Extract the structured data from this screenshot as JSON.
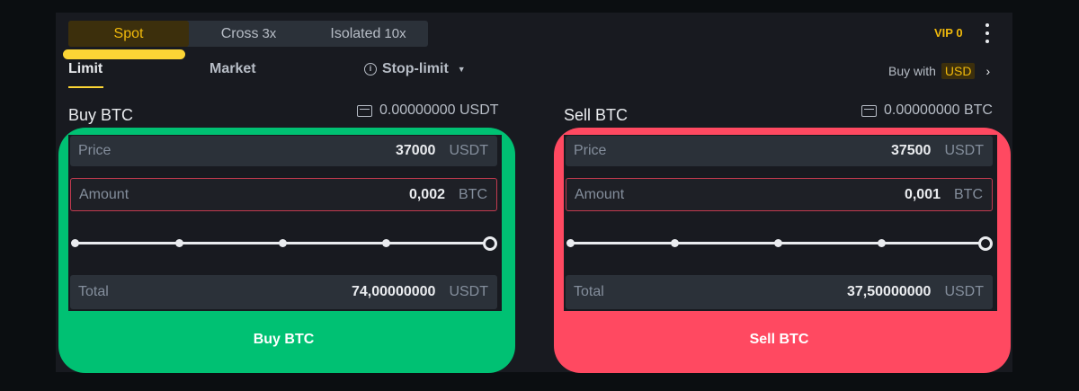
{
  "mode_tabs": [
    {
      "label": "Spot",
      "leverage": ""
    },
    {
      "label": "Cross",
      "leverage": "3x"
    },
    {
      "label": "Isolated",
      "leverage": "10x"
    }
  ],
  "vip_label": "VIP 0",
  "order_tabs": {
    "limit": "Limit",
    "market": "Market",
    "stop_limit": "Stop-limit"
  },
  "buy_with": {
    "label": "Buy with",
    "currency": "USD"
  },
  "buy": {
    "title": "Buy BTC",
    "balance": "0.00000000 USDT",
    "price": {
      "label": "Price",
      "value": "37000",
      "unit": "USDT"
    },
    "amount": {
      "label": "Amount",
      "value": "0,002",
      "unit": "BTC"
    },
    "total": {
      "label": "Total",
      "value": "74,00000000",
      "unit": "USDT"
    },
    "slider_percent": 100,
    "button": "Buy BTC"
  },
  "sell": {
    "title": "Sell BTC",
    "balance": "0.00000000 BTC",
    "price": {
      "label": "Price",
      "value": "37500",
      "unit": "USDT"
    },
    "amount": {
      "label": "Amount",
      "value": "0,001",
      "unit": "BTC"
    },
    "total": {
      "label": "Total",
      "value": "37,50000000",
      "unit": "USDT"
    },
    "slider_percent": 100,
    "button": "Sell BTC"
  },
  "colors": {
    "accent": "#f0b90b",
    "buy": "#00c173",
    "sell": "#ff4961",
    "panel": "#181a20"
  },
  "icons": [
    "info-icon",
    "wallet-icon",
    "kebab-menu-icon",
    "chevron-right-icon",
    "caret-down-icon"
  ]
}
